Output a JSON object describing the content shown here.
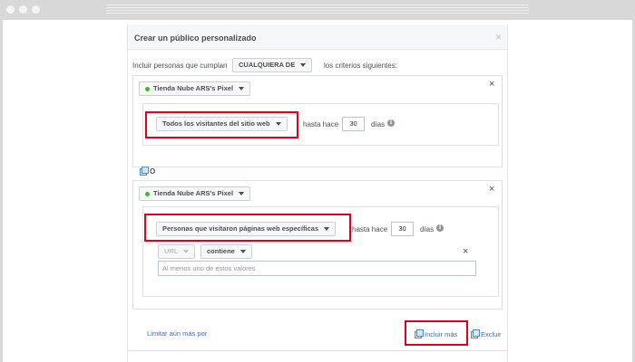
{
  "dialog": {
    "title": "Crear un público personalizado",
    "close": "×"
  },
  "criteria": {
    "prefix": "Incluir personas que cumplan",
    "dropdown": "CUALQUIERA DE",
    "suffix": "los criterios siguientes:"
  },
  "rule1": {
    "pixel": "Tienda Nube ARS's Pixel",
    "event": "Todos los visitantes del sitio web",
    "since_label": "hasta hace",
    "days_value": "30",
    "days_label": "días"
  },
  "separator": {
    "label": "O"
  },
  "rule2": {
    "pixel": "Tienda Nube ARS's Pixel",
    "event": "Personas que visitaron páginas web específicas",
    "since_label": "hasta hace",
    "days_value": "30",
    "days_label": "días",
    "url_label": "URL",
    "condition": "contiene",
    "placeholder": "Al menos uno de estos valores",
    "limit_link": "Limitar aún más por"
  },
  "footer": {
    "include_more": "Incluir más",
    "exclude": "Excluir"
  },
  "icons": {
    "close": "×",
    "info": "i"
  }
}
